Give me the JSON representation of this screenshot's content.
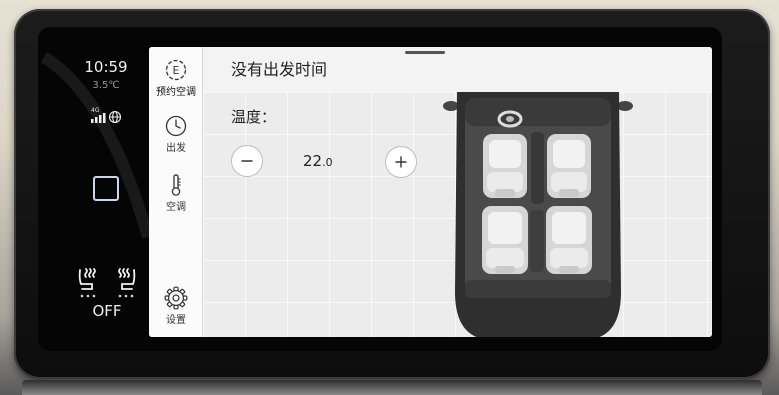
{
  "status_bar": {
    "time": "10:59",
    "outside_temperature": "3.5℃",
    "network_type": "4G",
    "seat_heating_status": "OFF"
  },
  "sidebar": {
    "items": [
      {
        "label": "预约空调",
        "icon": "e-charging-icon",
        "selected": true
      },
      {
        "label": "出发",
        "icon": "clock-icon",
        "selected": false
      },
      {
        "label": "空调",
        "icon": "thermometer-icon",
        "selected": false
      },
      {
        "label": "设置",
        "icon": "gear-icon",
        "selected": false
      }
    ],
    "charging_icon_letter": "E"
  },
  "header": {
    "title": "没有出发时间"
  },
  "climate": {
    "temperature_label": "温度：",
    "temperature_integer": "22",
    "temperature_decimal": ".0",
    "decrease_icon": "minus-icon",
    "increase_icon": "plus-icon"
  },
  "colors": {
    "panel_background": "#ffffff",
    "screen_background": "#050505",
    "outline_accent": "#c9d6ee",
    "text_primary": "#222222",
    "seat_color": "#e9e9e9",
    "car_body": "#2f2f2f"
  }
}
